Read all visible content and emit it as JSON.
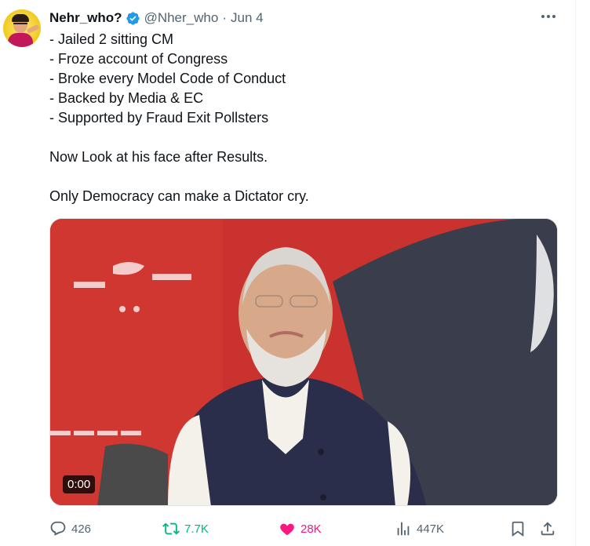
{
  "tweet": {
    "display_name": "Nehr_who?",
    "handle": "@Nher_who",
    "separator": "·",
    "date": "Jun 4",
    "lines": [
      "- Jailed 2 sitting CM",
      "- Froze account of Congress",
      "- Broke every Model Code of Conduct",
      "- Backed by Media & EC",
      "- Supported by Fraud Exit Pollsters",
      "",
      "Now Look at his face after Results.",
      "",
      "Only Democracy can make a Dictator cry."
    ]
  },
  "media": {
    "timecode": "0:00"
  },
  "actions": {
    "replies": "426",
    "reposts": "7.7K",
    "likes": "28K",
    "views": "447K"
  },
  "icons": {
    "verified": "verified-badge-icon",
    "more": "more-options-icon",
    "reply": "reply-icon",
    "retweet": "retweet-icon",
    "like": "heart-icon",
    "views": "views-icon",
    "bookmark": "bookmark-icon",
    "share": "share-icon"
  },
  "colors": {
    "text": "#0f1419",
    "secondary": "#536471",
    "verified": "#1d9bf0",
    "retweet_active": "#00ba7c",
    "like_active": "#f91880"
  }
}
